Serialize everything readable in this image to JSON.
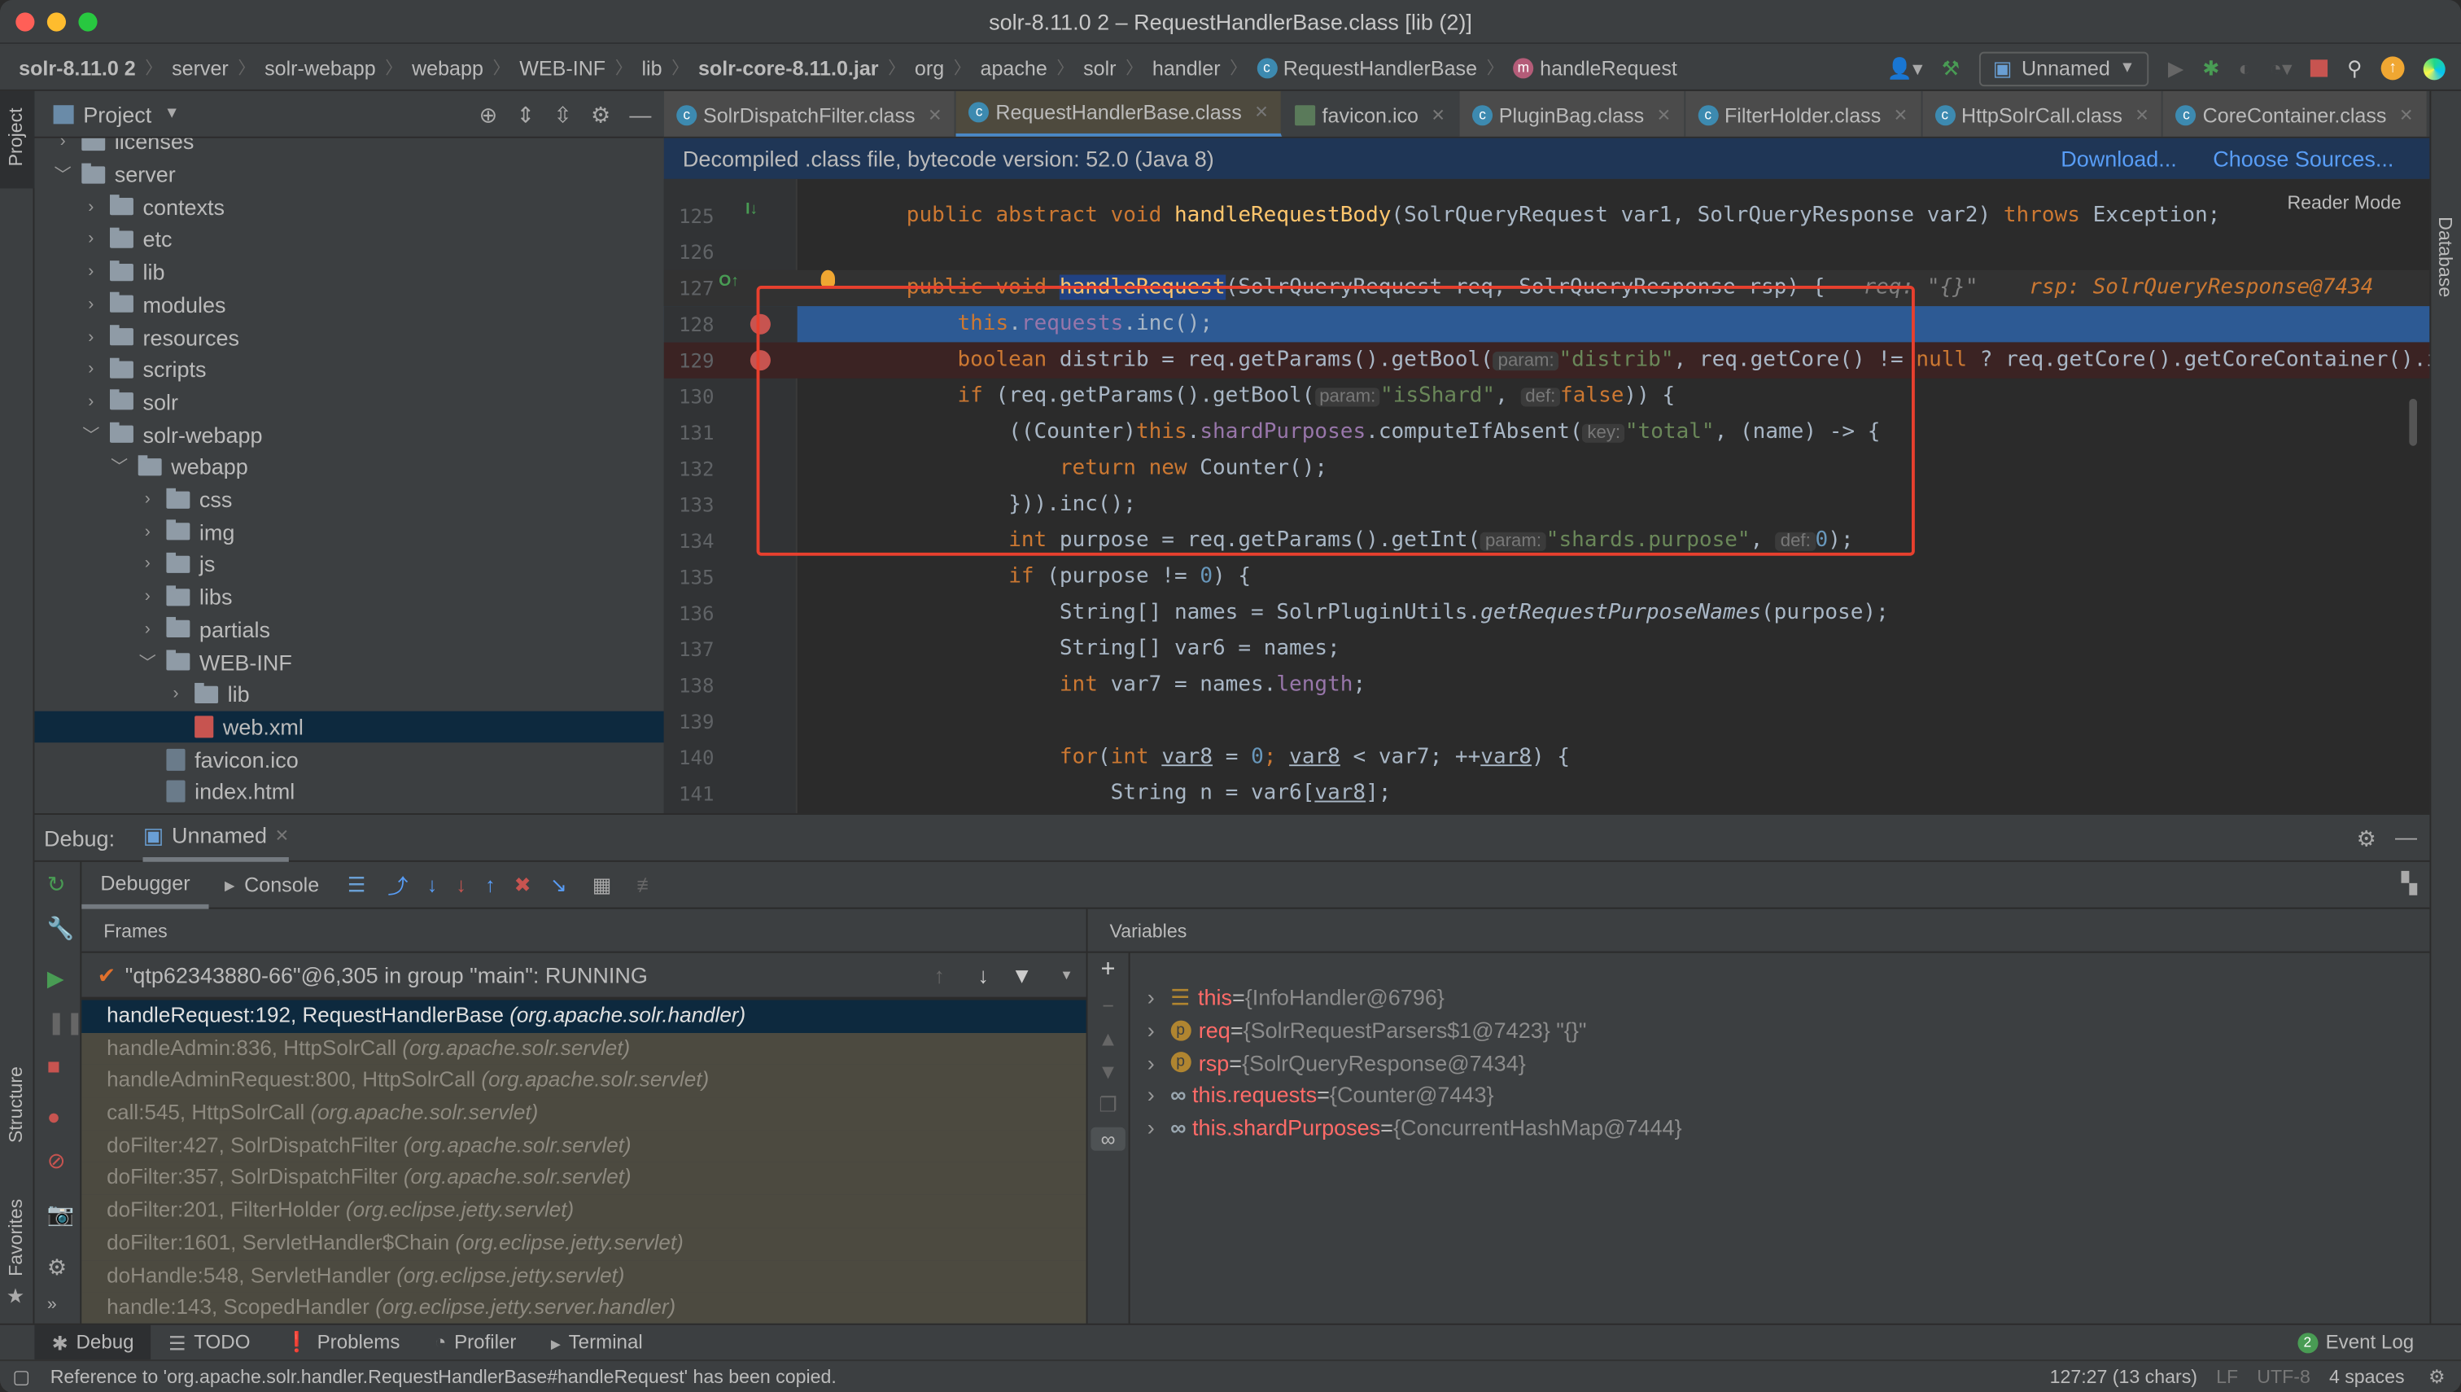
{
  "window": {
    "title": "solr-8.11.0 2 – RequestHandlerBase.class [lib (2)]"
  },
  "breadcrumbs": [
    "solr-8.11.0 2",
    "server",
    "solr-webapp",
    "webapp",
    "WEB-INF",
    "lib",
    "solr-core-8.11.0.jar",
    "org",
    "apache",
    "solr",
    "handler",
    "RequestHandlerBase",
    "handleRequest"
  ],
  "toolbar": {
    "run_config": "Unnamed"
  },
  "project": {
    "title": "Project",
    "tree": [
      {
        "label": "licenses",
        "depth": 1,
        "type": "folder",
        "expanded": false
      },
      {
        "label": "server",
        "depth": 1,
        "type": "folder",
        "expanded": true
      },
      {
        "label": "contexts",
        "depth": 2,
        "type": "folder",
        "expanded": false
      },
      {
        "label": "etc",
        "depth": 2,
        "type": "folder",
        "expanded": false
      },
      {
        "label": "lib",
        "depth": 2,
        "type": "folder",
        "expanded": false
      },
      {
        "label": "modules",
        "depth": 2,
        "type": "folder",
        "expanded": false
      },
      {
        "label": "resources",
        "depth": 2,
        "type": "folder",
        "expanded": false
      },
      {
        "label": "scripts",
        "depth": 2,
        "type": "folder",
        "expanded": false
      },
      {
        "label": "solr",
        "depth": 2,
        "type": "folder",
        "expanded": false
      },
      {
        "label": "solr-webapp",
        "depth": 2,
        "type": "folder",
        "expanded": true
      },
      {
        "label": "webapp",
        "depth": 3,
        "type": "folder",
        "expanded": true
      },
      {
        "label": "css",
        "depth": 4,
        "type": "folder",
        "expanded": false
      },
      {
        "label": "img",
        "depth": 4,
        "type": "folder",
        "expanded": false
      },
      {
        "label": "js",
        "depth": 4,
        "type": "folder",
        "expanded": false
      },
      {
        "label": "libs",
        "depth": 4,
        "type": "folder",
        "expanded": false
      },
      {
        "label": "partials",
        "depth": 4,
        "type": "folder",
        "expanded": false
      },
      {
        "label": "WEB-INF",
        "depth": 4,
        "type": "folder",
        "expanded": true
      },
      {
        "label": "lib",
        "depth": 5,
        "type": "folder",
        "expanded": false
      },
      {
        "label": "web.xml",
        "depth": 5,
        "type": "file",
        "selected": true
      },
      {
        "label": "favicon.ico",
        "depth": 4,
        "type": "file"
      },
      {
        "label": "index.html",
        "depth": 4,
        "type": "file"
      }
    ]
  },
  "tabs": [
    {
      "label": "SolrDispatchFilter.class"
    },
    {
      "label": "RequestHandlerBase.class",
      "active": true
    },
    {
      "label": "favicon.ico",
      "plain": true
    },
    {
      "label": "PluginBag.class"
    },
    {
      "label": "FilterHolder.class"
    },
    {
      "label": "HttpSolrCall.class"
    },
    {
      "label": "CoreContainer.class"
    }
  ],
  "banner": {
    "text": "Decompiled .class file, bytecode version: 52.0 (Java 8)",
    "download": "Download...",
    "choose_sources": "Choose Sources..."
  },
  "editor": {
    "reader_mode": "Reader Mode",
    "lines": [
      {
        "n": "125",
        "t": [
          [
            "    "
          ],
          [
            "public abstract void ",
            "kw"
          ],
          [
            "handleRequestBody",
            "fn"
          ],
          [
            "(SolrQueryRequest var1, SolrQueryResponse var2) ",
            "pl"
          ],
          [
            "throws ",
            "kw"
          ],
          [
            "Exception;",
            "pl"
          ]
        ]
      },
      {
        "n": "126",
        "t": []
      },
      {
        "n": "127",
        "state": "cur",
        "t": [
          [
            "    "
          ],
          [
            "public void ",
            "kw"
          ],
          [
            "handleRequest",
            "hl"
          ],
          [
            "(SolrQueryRequest req, SolrQueryResponse rsp) {   ",
            "pl"
          ],
          [
            "req: \"{}\"    ",
            "cm"
          ],
          [
            "rsp: SolrQueryResponse@7434",
            "inl"
          ]
        ]
      },
      {
        "n": "128",
        "state": "exec",
        "t": [
          [
            "        "
          ],
          [
            "this",
            "kw"
          ],
          [
            ".",
            "pl"
          ],
          [
            "requests",
            "fld"
          ],
          [
            ".inc();",
            "pl"
          ]
        ]
      },
      {
        "n": "129",
        "state": "bp",
        "t": [
          [
            "        "
          ],
          [
            "boolean ",
            "kw"
          ],
          [
            "distrib = req.getParams().getBool(",
            "pl"
          ],
          [
            "param:",
            "hint"
          ],
          [
            "\"distrib\"",
            "str"
          ],
          [
            ", req.getCore() != ",
            "pl"
          ],
          [
            "null",
            "kw"
          ],
          [
            " ? req.getCore().getCoreContainer().isZ",
            "pl"
          ]
        ]
      },
      {
        "n": "130",
        "t": [
          [
            "        "
          ],
          [
            "if ",
            "kw"
          ],
          [
            "(req.getParams().getBool(",
            "pl"
          ],
          [
            "param:",
            "hint"
          ],
          [
            "\"isShard\"",
            "str"
          ],
          [
            ", ",
            "pl"
          ],
          [
            "def:",
            "hint"
          ],
          [
            "false",
            "kw"
          ],
          [
            ")) {",
            "pl"
          ]
        ]
      },
      {
        "n": "131",
        "t": [
          [
            "            "
          ],
          [
            "((Counter)",
            "pl"
          ],
          [
            "this",
            "kw"
          ],
          [
            ".",
            "pl"
          ],
          [
            "shardPurposes",
            "fld"
          ],
          [
            ".computeIfAbsent(",
            "pl"
          ],
          [
            "key:",
            "hint"
          ],
          [
            "\"total\"",
            "str"
          ],
          [
            ", (name) -> {",
            "pl"
          ]
        ]
      },
      {
        "n": "132",
        "t": [
          [
            "                "
          ],
          [
            "return new ",
            "kw"
          ],
          [
            "Counter();",
            "pl"
          ]
        ]
      },
      {
        "n": "133",
        "t": [
          [
            "            "
          ],
          [
            "})).inc();",
            "pl"
          ]
        ]
      },
      {
        "n": "134",
        "t": [
          [
            "            "
          ],
          [
            "int ",
            "kw"
          ],
          [
            "purpose = req.getParams().getInt(",
            "pl"
          ],
          [
            "param:",
            "hint"
          ],
          [
            "\"shards.purpose\"",
            "str"
          ],
          [
            ", ",
            "pl"
          ],
          [
            "def:",
            "hint"
          ],
          [
            "0",
            "num"
          ],
          [
            ");",
            "pl"
          ]
        ]
      },
      {
        "n": "135",
        "t": [
          [
            "            "
          ],
          [
            "if ",
            "kw"
          ],
          [
            "(purpose != ",
            "pl"
          ],
          [
            "0",
            "num"
          ],
          [
            ") {",
            "pl"
          ]
        ]
      },
      {
        "n": "136",
        "t": [
          [
            "                "
          ],
          [
            "String[] names = SolrPluginUtils.",
            "pl"
          ],
          [
            "getRequestPurposeNames",
            "it"
          ],
          [
            "(purpose);",
            "pl"
          ]
        ]
      },
      {
        "n": "137",
        "t": [
          [
            "                "
          ],
          [
            "String[] var6 = names;",
            "pl"
          ]
        ]
      },
      {
        "n": "138",
        "t": [
          [
            "                "
          ],
          [
            "int ",
            "kw"
          ],
          [
            "var7 = names.",
            "pl"
          ],
          [
            "length",
            "fld"
          ],
          [
            ";",
            "pl"
          ]
        ]
      },
      {
        "n": "139",
        "t": []
      },
      {
        "n": "140",
        "t": [
          [
            "                "
          ],
          [
            "for",
            "kw"
          ],
          [
            "(",
            "pl"
          ],
          [
            "int ",
            "kw"
          ],
          [
            "var8",
            "ul"
          ],
          [
            " = ",
            "pl"
          ],
          [
            "0",
            "num"
          ],
          [
            "; ",
            "kw"
          ],
          [
            "var8",
            "ul"
          ],
          [
            " < var7; ++",
            "pl"
          ],
          [
            "var8",
            "ul"
          ],
          [
            ") {",
            "pl"
          ]
        ]
      },
      {
        "n": "141",
        "t": [
          [
            "                    "
          ],
          [
            "String n = var6[",
            "pl"
          ],
          [
            "var8",
            "ul"
          ],
          [
            "];",
            "pl"
          ]
        ]
      }
    ]
  },
  "debug": {
    "label": "Debug:",
    "session": "Unnamed",
    "tabs": [
      "Debugger",
      "Console"
    ],
    "frames_title": "Frames",
    "variables_title": "Variables",
    "thread": "\"qtp62343880-66\"@6,305 in group \"main\": RUNNING",
    "frames": [
      {
        "method": "handleRequest:192, RequestHandlerBase",
        "pkg": "(org.apache.solr.handler)",
        "selected": true
      },
      {
        "method": "handleAdmin:836, HttpSolrCall",
        "pkg": "(org.apache.solr.servlet)"
      },
      {
        "method": "handleAdminRequest:800, HttpSolrCall",
        "pkg": "(org.apache.solr.servlet)"
      },
      {
        "method": "call:545, HttpSolrCall",
        "pkg": "(org.apache.solr.servlet)"
      },
      {
        "method": "doFilter:427, SolrDispatchFilter",
        "pkg": "(org.apache.solr.servlet)"
      },
      {
        "method": "doFilter:357, SolrDispatchFilter",
        "pkg": "(org.apache.solr.servlet)"
      },
      {
        "method": "doFilter:201, FilterHolder",
        "pkg": "(org.eclipse.jetty.servlet)"
      },
      {
        "method": "doFilter:1601, ServletHandler$Chain",
        "pkg": "(org.eclipse.jetty.servlet)"
      },
      {
        "method": "doHandle:548, ServletHandler",
        "pkg": "(org.eclipse.jetty.servlet)"
      },
      {
        "method": "handle:143, ScopedHandler",
        "pkg": "(org.eclipse.jetty.server.handler)"
      }
    ],
    "variables": [
      {
        "icon": "field",
        "name": "this",
        "value": "{InfoHandler@6796}"
      },
      {
        "icon": "param",
        "name": "req",
        "value": "{SolrRequestParsers$1@7423} \"{}\""
      },
      {
        "icon": "param",
        "name": "rsp",
        "value": "{SolrQueryResponse@7434}"
      },
      {
        "icon": "watch",
        "name": "this.requests",
        "value": "{Counter@7443}"
      },
      {
        "icon": "watch",
        "name": "this.shardPurposes",
        "value": "{ConcurrentHashMap@7444}"
      }
    ]
  },
  "bottom_tabs": [
    "Debug",
    "TODO",
    "Problems",
    "Profiler",
    "Terminal"
  ],
  "event_log": {
    "count": "2",
    "label": "Event Log"
  },
  "side_labels": {
    "project": "Project",
    "structure": "Structure",
    "favorites": "Favorites",
    "database": "Database"
  },
  "status": {
    "message": "Reference to 'org.apache.solr.handler.RequestHandlerBase#handleRequest' has been copied.",
    "position": "127:27 (13 chars)",
    "line_sep": "LF",
    "encoding": "UTF-8",
    "indent": "4 spaces"
  },
  "colors": {
    "accent": "#4a88c7",
    "breakpoint": "#c75450",
    "highlight_box": "#e8402e",
    "exec_line": "#2d5a94"
  }
}
